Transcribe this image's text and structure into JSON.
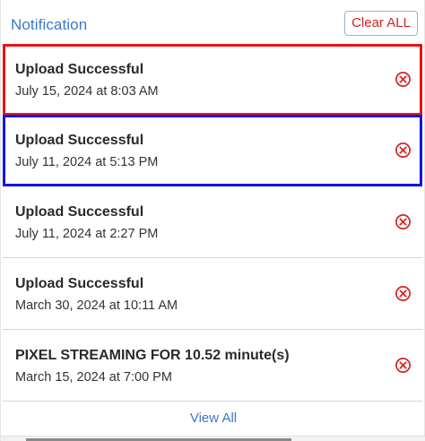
{
  "header": {
    "title": "Notification",
    "clear_label": "Clear ALL"
  },
  "notifications": [
    {
      "title": "Upload Successful",
      "date": "July 15, 2024 at 8:03 AM",
      "highlight": "red"
    },
    {
      "title": "Upload Successful",
      "date": "July 11, 2024 at 5:13 PM",
      "highlight": "blue"
    },
    {
      "title": "Upload Successful",
      "date": "July 11, 2024 at 2:27 PM",
      "highlight": "none"
    },
    {
      "title": "Upload Successful",
      "date": "March 30, 2024 at 10:11 AM",
      "highlight": "none"
    },
    {
      "title": "PIXEL STREAMING FOR 10.52 minute(s)",
      "date": "March 15, 2024 at 7:00 PM",
      "highlight": "none"
    }
  ],
  "footer": {
    "view_all_label": "View All"
  },
  "colors": {
    "accent_blue": "#3a78c9",
    "close_red": "#d32424",
    "highlight_red": "#ee1111",
    "highlight_blue": "#1414e6"
  },
  "icons": {
    "dismiss": "close-circle-icon"
  }
}
